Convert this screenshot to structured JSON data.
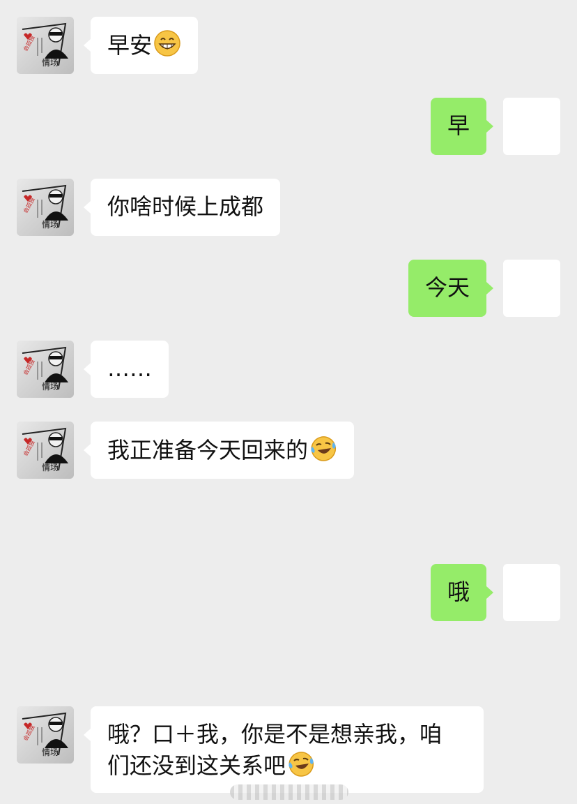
{
  "messages": [
    {
      "side": "in",
      "text": "早安",
      "emoji": "grin-emoji"
    },
    {
      "side": "out",
      "text": "早"
    },
    {
      "side": "in",
      "text": "你啥时候上成都"
    },
    {
      "side": "out",
      "text": "今天"
    },
    {
      "side": "in",
      "text": "……"
    },
    {
      "side": "in",
      "text": "我正准备今天回来的",
      "emoji": "tears-of-joy-emoji"
    },
    {
      "side": "out",
      "text": "哦"
    },
    {
      "side": "in",
      "line1": "哦？口＋我，你是不是想亲我，咱",
      "line2": "们还没到这关系吧",
      "emoji": "tears-of-joy-emoji"
    }
  ],
  "colors": {
    "background": "#ededed",
    "incoming": "#ffffff",
    "outgoing": "#95ec69"
  },
  "avatar_art_text": "情场"
}
